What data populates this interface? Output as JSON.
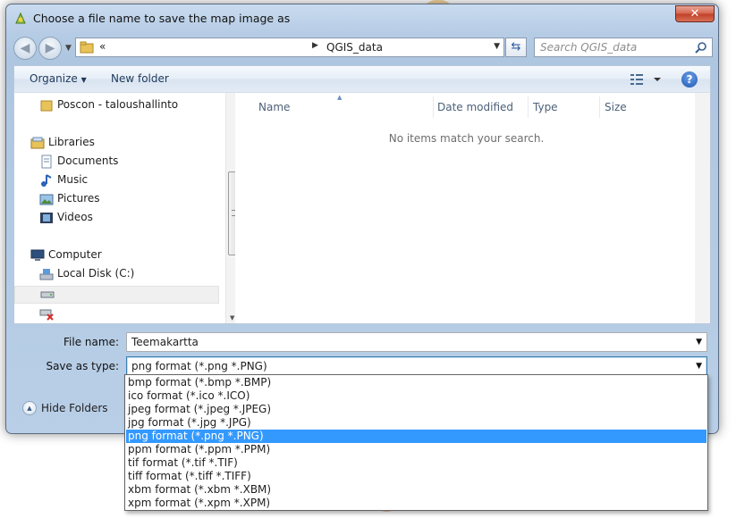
{
  "window": {
    "title": "Choose a file name to save the map image as",
    "close_label": "✕"
  },
  "address": {
    "back_glyph": "«",
    "current_folder": "QGIS_data"
  },
  "search": {
    "placeholder": "Search QGIS_data"
  },
  "toolbar": {
    "organize_label": "Organize",
    "new_folder_label": "New folder",
    "help_label": "?"
  },
  "nav": {
    "items": [
      {
        "label": "Poscon - taloushallinto",
        "icon": "folder-icon"
      },
      {
        "label": "Libraries",
        "icon": "libraries-icon"
      },
      {
        "label": "Documents",
        "icon": "documents-icon"
      },
      {
        "label": "Music",
        "icon": "music-icon"
      },
      {
        "label": "Pictures",
        "icon": "pictures-icon"
      },
      {
        "label": "Videos",
        "icon": "videos-icon"
      },
      {
        "label": "Computer",
        "icon": "computer-icon"
      },
      {
        "label": "Local Disk (C:)",
        "icon": "local-disk-icon"
      }
    ]
  },
  "columns": {
    "name": "Name",
    "date_modified": "Date modified",
    "type": "Type",
    "size": "Size"
  },
  "list": {
    "empty_text": "No items match your search."
  },
  "form": {
    "file_name_label": "File name:",
    "file_name_value": "Teemakartta",
    "save_type_label": "Save as type:",
    "save_type_value": "png format (*.png *.PNG)",
    "hide_folders_label": "Hide Folders"
  },
  "type_options": [
    "bmp format (*.bmp *.BMP)",
    "ico format (*.ico *.ICO)",
    "jpeg format (*.jpeg *.JPEG)",
    "jpg format (*.jpg *.JPG)",
    "png format (*.png *.PNG)",
    "ppm format (*.ppm *.PPM)",
    "tif format (*.tif *.TIF)",
    "tiff format (*.tiff *.TIFF)",
    "xbm format (*.xbm *.XBM)",
    "xpm format (*.xpm *.XPM)"
  ],
  "selected_type_index": 4,
  "colors": {
    "selection": "#3399ff",
    "accent": "#1e395b"
  }
}
